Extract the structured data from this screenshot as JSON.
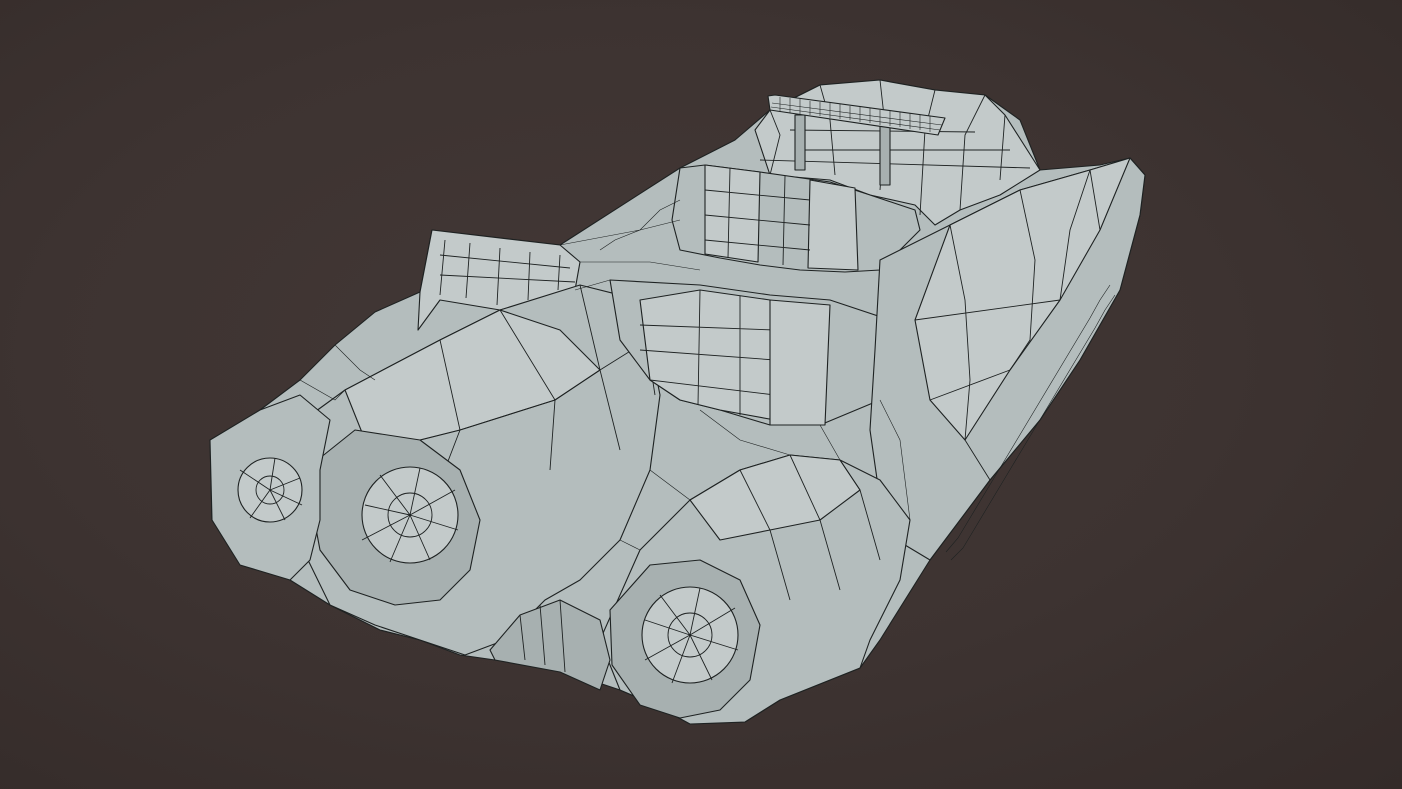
{
  "scene": {
    "subject": "wireframe-spaceship-model",
    "colors": {
      "background": "#3d3331",
      "mesh_fill": "#b4bdbd",
      "mesh_fill_dark": "#a6afaf",
      "mesh_fill_light": "#c2caca",
      "wire": "#1e2222"
    }
  }
}
